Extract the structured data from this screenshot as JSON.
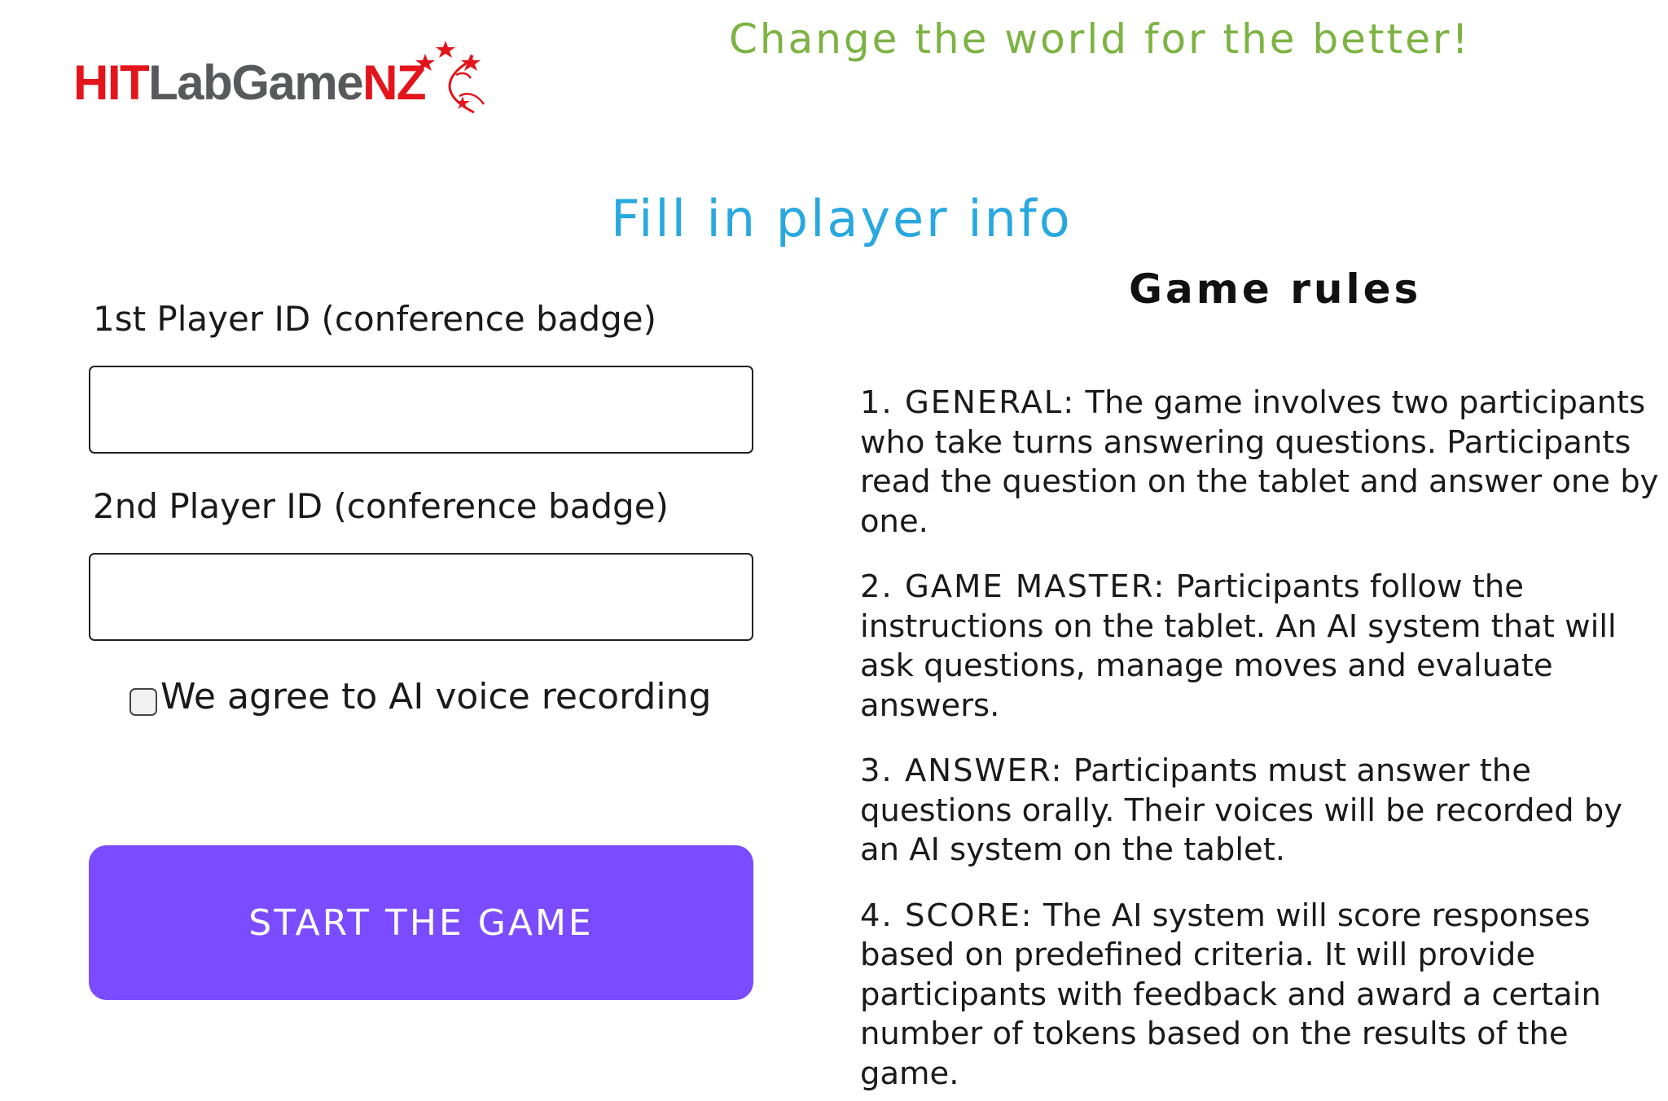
{
  "logo": {
    "part1": "HIT",
    "part2": "LabGame",
    "part3": "NZ",
    "icon": "fern-stars-logo-icon"
  },
  "tagline": "Change the world for the better!",
  "title": "Fill in player info",
  "form": {
    "player1_label": "1st Player ID (conference badge)",
    "player1_value": "",
    "player2_label": "2nd Player ID (conference badge)",
    "player2_value": "",
    "consent_label": "We agree to AI voice recording",
    "consent_checked": false,
    "start_label": "START THE GAME"
  },
  "rules": {
    "title": "Game rules",
    "items": [
      {
        "head": "1. GENERAL:",
        "body": " The game involves two participants who take turns answering questions. Participants read the question on the tablet and answer one by one."
      },
      {
        "head": "2. GAME MASTER:",
        "body": " Participants follow the instructions on the tablet. An AI system that will ask questions, manage moves and evaluate answers."
      },
      {
        "head": "3. ANSWER:",
        "body": " Participants must answer the questions orally. Their voices will be recorded by an AI system on the tablet."
      },
      {
        "head": "4. SCORE:",
        "body": " The AI system will score responses based on predefined criteria. It will provide participants with feedback and award a certain number of tokens based on the results of the game."
      }
    ]
  },
  "colors": {
    "logo_red": "#e3141b",
    "logo_gray": "#58595b",
    "tagline_green": "#7cb342",
    "title_blue": "#29a8e0",
    "button_purple": "#7b4cff"
  }
}
